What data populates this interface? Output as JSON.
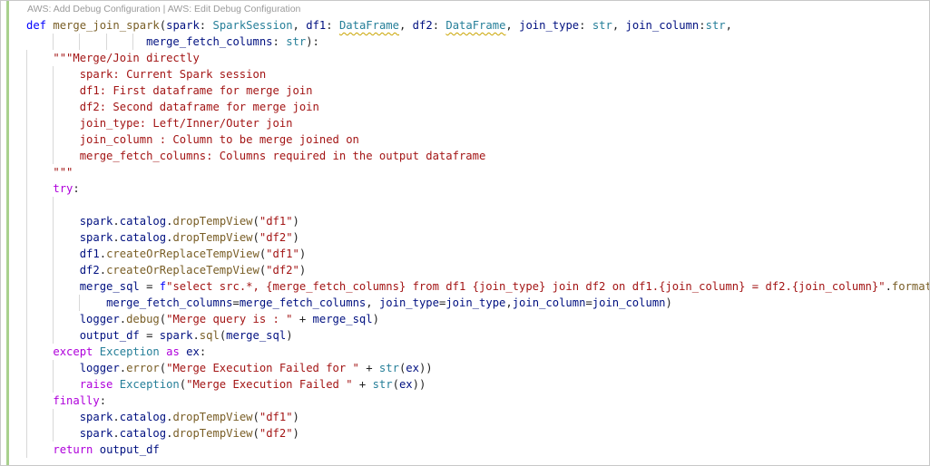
{
  "codelens": {
    "add_label": "AWS: Add Debug Configuration",
    "separator": " | ",
    "edit_label": "AWS: Edit Debug Configuration"
  },
  "code": {
    "kw_def": "def",
    "func_name": "merge_join_spark",
    "p_spark": "spark",
    "t_spark_session": "SparkSession",
    "p_df1": "df1",
    "t_dataframe": "DataFrame",
    "p_df2": "df2",
    "p_join_type": "join_type",
    "t_str": "str",
    "p_join_column": "join_column",
    "p_merge_fetch_columns": "merge_fetch_columns",
    "doc": [
      "\"\"\"Merge/Join directly",
      "spark: Current Spark session",
      "df1: First dataframe for merge join",
      "df2: Second dataframe for merge join",
      "join_type: Left/Inner/Outer join",
      "join_column : Column to be merge joined on",
      "merge_fetch_columns: Columns required in the output dataframe",
      "\"\"\""
    ],
    "kw_try": "try",
    "v_catalog": "catalog",
    "m_drop_temp_view": "dropTempView",
    "m_create_or_replace_temp_view": "createOrReplaceTempView",
    "s_df1": "\"df1\"",
    "s_df2": "\"df2\"",
    "v_merge_sql": "merge_sql",
    "fstring_prefix": "f",
    "fstring": "\"select src.*, {merge_fetch_columns} from df1 {join_type} join df2 on df1.{join_column} = df2.{join_column}\"",
    "m_format": "format",
    "v_logger": "logger",
    "m_debug": "debug",
    "s_merge_query": "\"Merge query is : \"",
    "v_output_df": "output_df",
    "m_sql": "sql",
    "kw_except": "except",
    "c_exception": "Exception",
    "kw_as": "as",
    "v_ex": "ex",
    "m_error": "error",
    "s_merge_failed_for": "\"Merge Execution Failed for \"",
    "f_str": "str",
    "kw_raise": "raise",
    "s_merge_failed": "\"Merge Execution Failed \"",
    "kw_finally": "finally",
    "kw_return": "return"
  },
  "colors": {
    "keyword": "#0000ff",
    "control": "#af00db",
    "function": "#795e26",
    "variable": "#001080",
    "class": "#267f99",
    "string": "#a31515",
    "gutter_modified": "#a9d18e"
  }
}
